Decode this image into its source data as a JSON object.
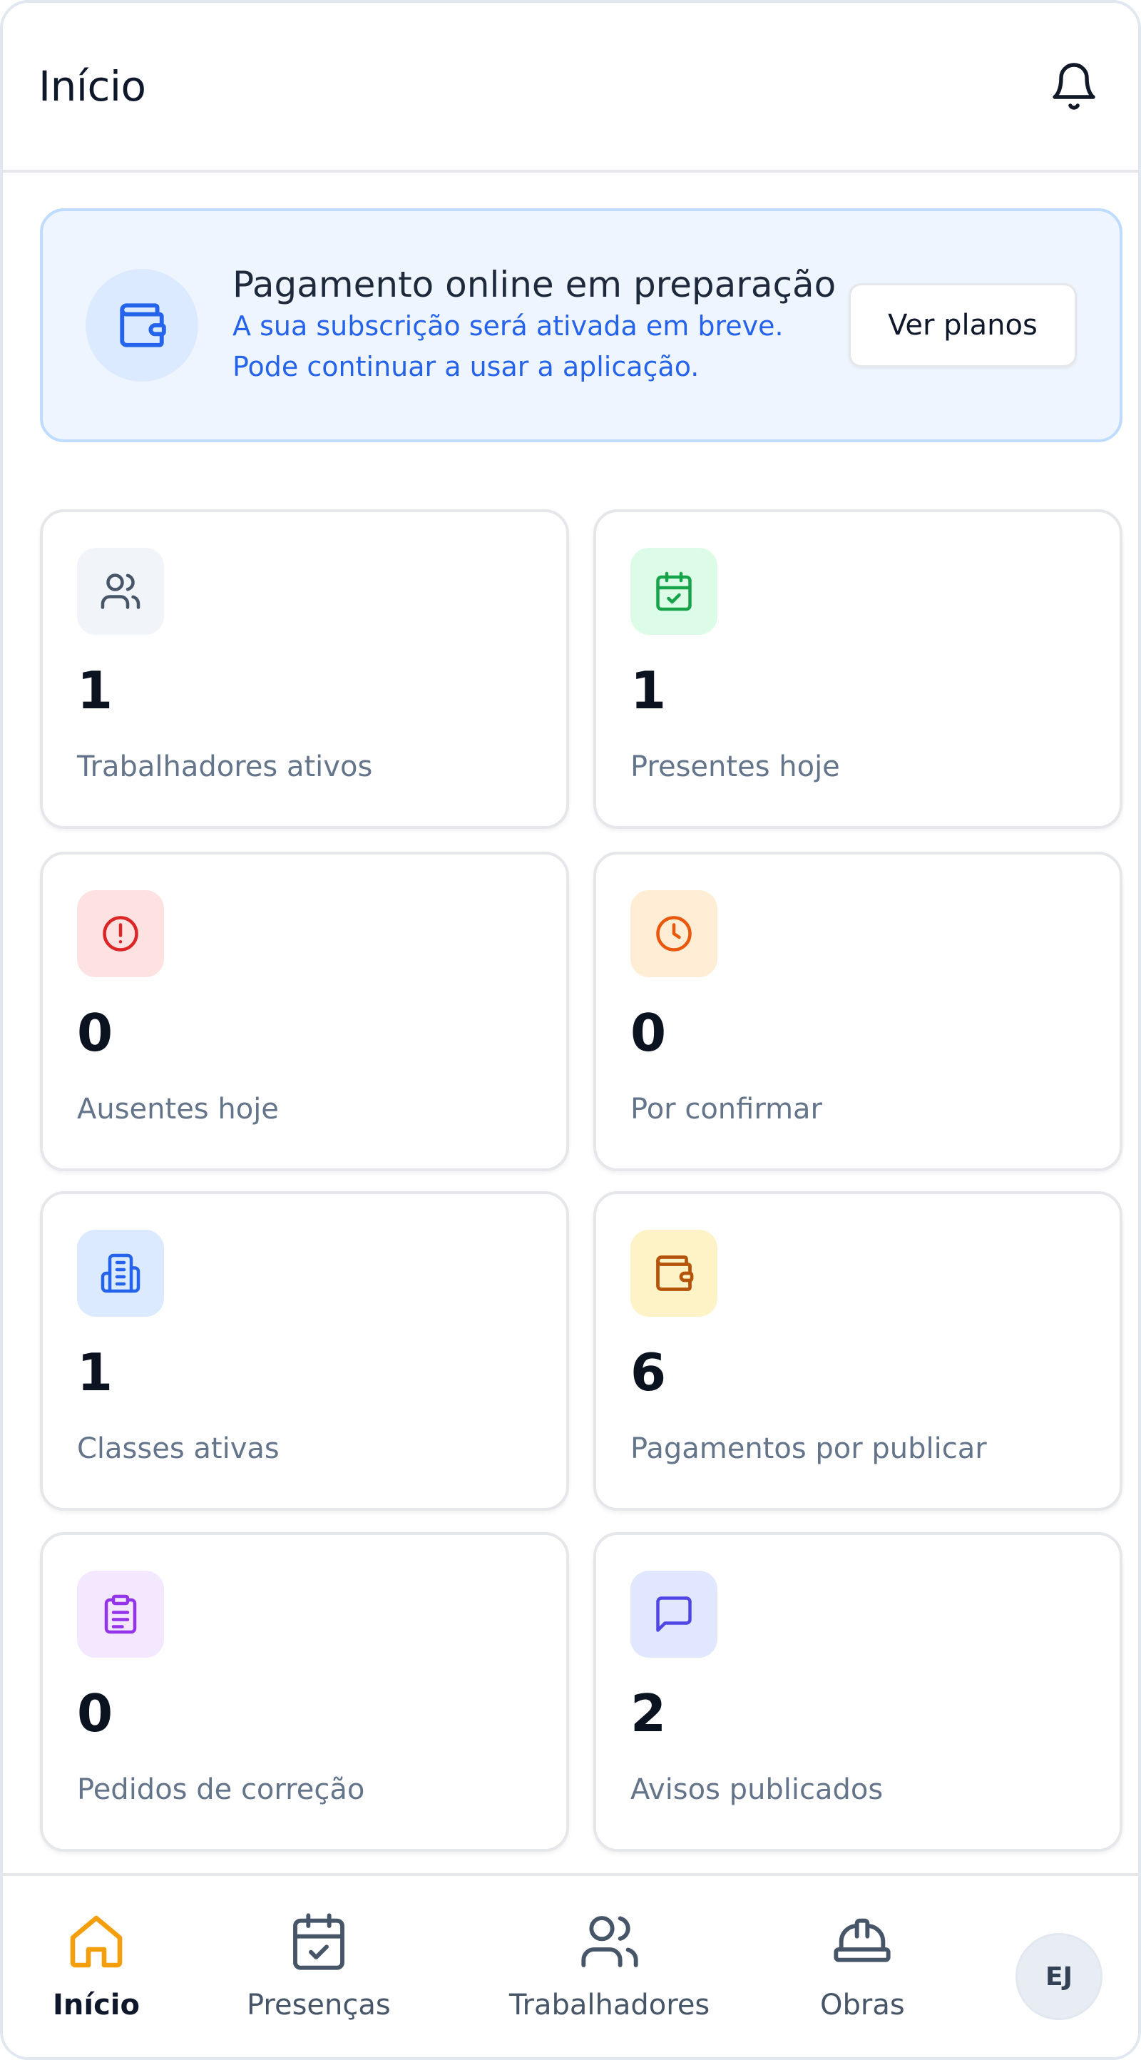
{
  "header": {
    "title": "Início",
    "bell_icon": "bell-icon"
  },
  "banner": {
    "icon": "wallet-icon",
    "title": "Pagamento online em preparação",
    "line1": "A sua subscrição será ativada em breve.",
    "line2": "Pode continuar a usar a aplicação.",
    "button_label": "Ver planos"
  },
  "stats": [
    {
      "value": "1",
      "label": "Trabalhadores ativos",
      "icon": "users-icon",
      "color": "#475569",
      "bg": "#f1f5f9"
    },
    {
      "value": "1",
      "label": "Presentes hoje",
      "icon": "calendar-check-icon",
      "color": "#16a34a",
      "bg": "#dcfce7"
    },
    {
      "value": "0",
      "label": "Ausentes hoje",
      "icon": "alert-circle-icon",
      "color": "#dc2626",
      "bg": "#fee2e2"
    },
    {
      "value": "0",
      "label": "Por confirmar",
      "icon": "clock-icon",
      "color": "#ea580c",
      "bg": "#ffedd5"
    },
    {
      "value": "1",
      "label": "Classes ativas",
      "icon": "building-icon",
      "color": "#2563eb",
      "bg": "#dbeafe"
    },
    {
      "value": "6",
      "label": "Pagamentos por publicar",
      "icon": "wallet-icon",
      "color": "#b45309",
      "bg": "#fef3c7"
    },
    {
      "value": "0",
      "label": "Pedidos de correção",
      "icon": "clipboard-icon",
      "color": "#9333ea",
      "bg": "#f3e8ff"
    },
    {
      "value": "2",
      "label": "Avisos publicados",
      "icon": "message-icon",
      "color": "#4f46e5",
      "bg": "#e0e7ff"
    }
  ],
  "nav": {
    "items": [
      {
        "label": "Início",
        "icon": "home-icon",
        "active": true,
        "color": "#f59e0b"
      },
      {
        "label": "Presenças",
        "icon": "calendar-check-icon",
        "active": false,
        "color": "#475569"
      },
      {
        "label": "Trabalhadores",
        "icon": "users-icon",
        "active": false,
        "color": "#475569"
      },
      {
        "label": "Obras",
        "icon": "hard-hat-icon",
        "active": false,
        "color": "#475569"
      }
    ],
    "avatar_initials": "EJ"
  }
}
